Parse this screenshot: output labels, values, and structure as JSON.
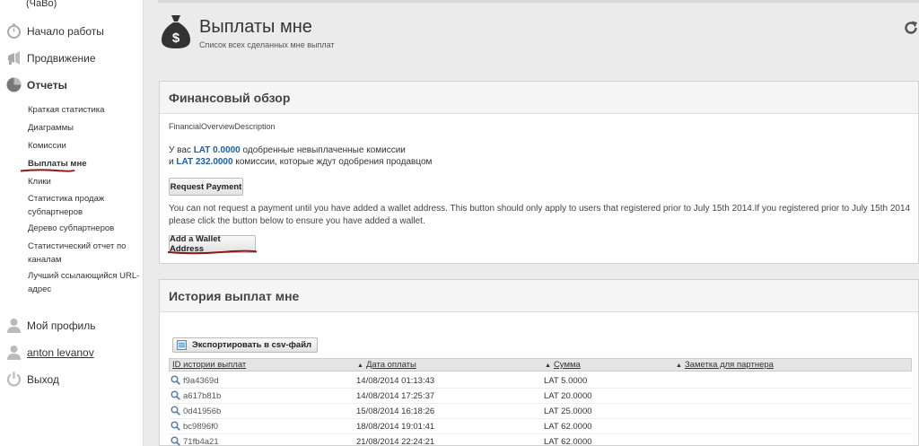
{
  "sidebar": {
    "top_partial": "(ЧаВо)",
    "nav": [
      {
        "label": "Начало работы",
        "icon": "stopwatch-icon"
      },
      {
        "label": "Продвижение",
        "icon": "megaphone-icon"
      },
      {
        "label": "Отчеты",
        "icon": "pie-chart-icon"
      }
    ],
    "reports_sub": [
      "Краткая статистика",
      "Диаграммы",
      "Комиссии",
      "Выплаты мне",
      "Клики",
      "Статистика продаж субпартнеров",
      "Дерево субпартнеров",
      "Статистический отчет по каналам",
      "Лучший ссылающийся URL-адрес"
    ],
    "bottom": [
      {
        "label": "Мой профиль",
        "icon": "user-icon"
      },
      {
        "label": "anton levanov",
        "icon": "user-icon"
      },
      {
        "label": "Выход",
        "icon": "power-icon"
      }
    ]
  },
  "header": {
    "title": "Выплаты мне",
    "subtitle": "Список всех сделанных мне выплат"
  },
  "financial": {
    "title": "Финансовый обзор",
    "description": "FinancialOverviewDescription",
    "line1_prefix": "У вас",
    "line1_amount": "LAT 0.0000",
    "line1_suffix": "одобренные невыплаченные комиссии",
    "line2_prefix": "и",
    "line2_amount": "LAT 232.0000",
    "line2_suffix": "комиссии, которые ждут одобрения продавцом",
    "request_button": "Request Payment",
    "notice": "You can not request a payment until you have added a wallet address. This button should only apply to users that registered prior to July 15th 2014.If you registered prior to July 15th 2014 please click the button below to ensure you have added a wallet.",
    "wallet_button": "Add a Wallet Address"
  },
  "history": {
    "title": "История выплат мне",
    "export_button": "Экспортировать в csv-файл",
    "columns": [
      "ID истории выплат",
      "Дата оплаты",
      "Сумма",
      "Заметка для партнера"
    ],
    "rows": [
      {
        "id": "f9a4369d",
        "date": "14/08/2014 01:13:43",
        "amount": "LAT 5.0000",
        "note": ""
      },
      {
        "id": "a617b81b",
        "date": "14/08/2014 17:25:37",
        "amount": "LAT 20.0000",
        "note": ""
      },
      {
        "id": "0d41956b",
        "date": "15/08/2014 16:18:26",
        "amount": "LAT 25.0000",
        "note": ""
      },
      {
        "id": "bc9896f0",
        "date": "18/08/2014 19:01:41",
        "amount": "LAT 62.0000",
        "note": ""
      },
      {
        "id": "71fb4a21",
        "date": "21/08/2014 22:24:21",
        "amount": "LAT 62.0000",
        "note": ""
      }
    ]
  },
  "colors": {
    "accent": "#1a5fa8",
    "underline_mark": "#8b1a1a"
  }
}
